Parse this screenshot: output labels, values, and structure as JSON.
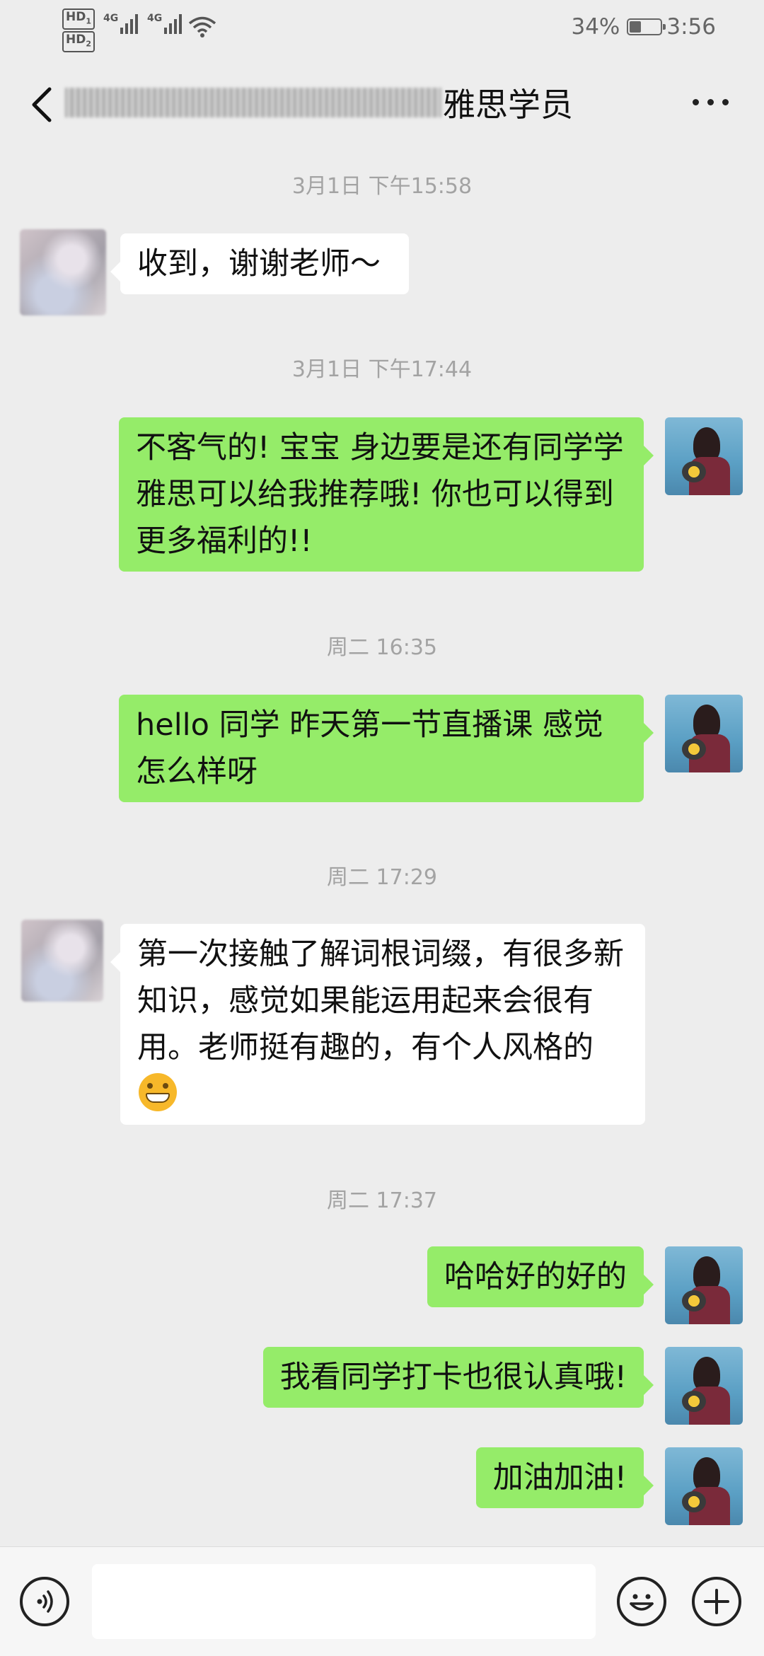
{
  "status_bar": {
    "hd1": "HD",
    "hd1_sub": "1",
    "hd2": "HD",
    "hd2_sub": "2",
    "sig1": "4G",
    "sig2": "4G",
    "battery": "34%",
    "battery_level": 0.34,
    "time": "3:56"
  },
  "header": {
    "back_icon": "chevron-left-icon",
    "title": "雅思学员",
    "more_icon": "more-dots-icon"
  },
  "messages": [
    {
      "type": "time",
      "text": "3月1日 下午15:58"
    },
    {
      "type": "in",
      "text": "收到，谢谢老师～"
    },
    {
      "type": "time",
      "text": "3月1日 下午17:44"
    },
    {
      "type": "out",
      "text": "不客气的! 宝宝 身边要是还有同学学雅思可以给我推荐哦! 你也可以得到更多福利的!!"
    },
    {
      "type": "time",
      "text": "周二 16:35"
    },
    {
      "type": "out",
      "text": "hello 同学 昨天第一节直播课 感觉怎么样呀"
    },
    {
      "type": "time",
      "text": "周二 17:29"
    },
    {
      "type": "in",
      "text": "第一次接触了解词根词缀，有很多新知识，感觉如果能运用起来会很有用。老师挺有趣的，有个人风格的",
      "emoji": "grinning-face-emoji"
    },
    {
      "type": "time",
      "text": "周二 17:37"
    },
    {
      "type": "out",
      "text": "哈哈好的好的"
    },
    {
      "type": "out",
      "text": "我看同学打卡也很认真哦!"
    },
    {
      "type": "out",
      "text": "加油加油!"
    }
  ],
  "bottom_bar": {
    "voice_icon": "voice-icon",
    "input_value": "",
    "emoji_icon": "emoji-icon",
    "plus_icon": "plus-icon"
  },
  "colors": {
    "background": "#ededed",
    "bubble_out": "#95ec69",
    "bubble_in": "#ffffff",
    "timestamp": "#a3a3a3"
  }
}
